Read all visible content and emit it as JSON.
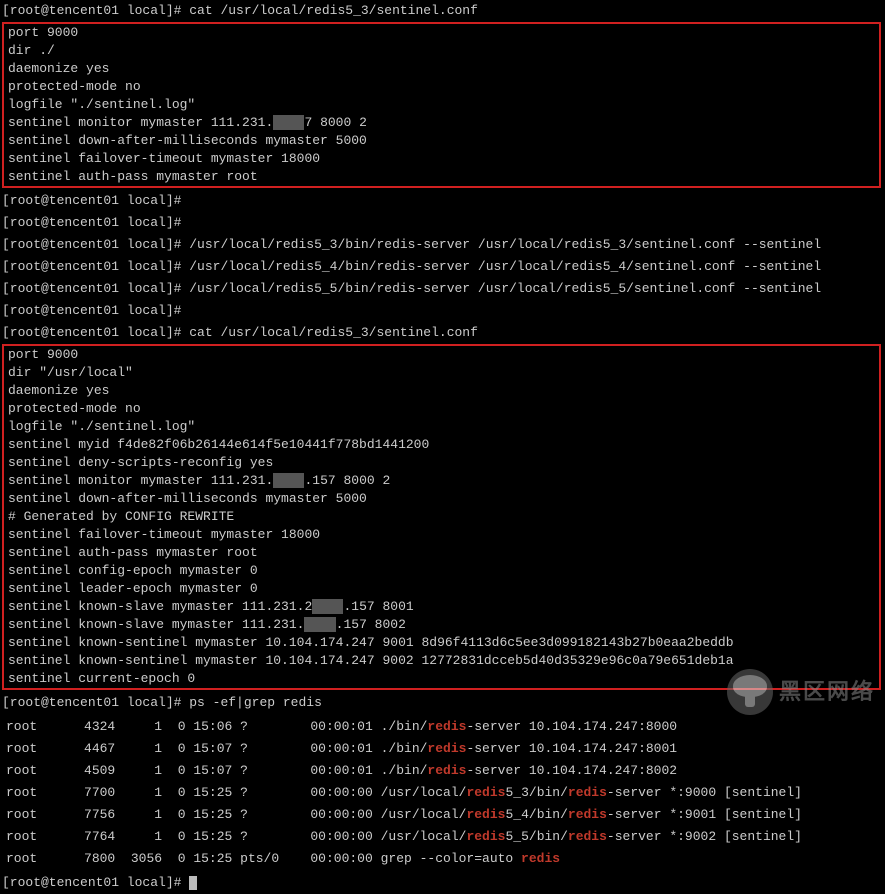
{
  "prompts": {
    "host": "[root@tencent01 local]#",
    "cmd_cat1": "cat /usr/local/redis5_3/sentinel.conf",
    "cmd_empty": "",
    "cmd_start3": "/usr/local/redis5_3/bin/redis-server /usr/local/redis5_3/sentinel.conf --sentinel",
    "cmd_start4": "/usr/local/redis5_4/bin/redis-server /usr/local/redis5_4/sentinel.conf --sentinel",
    "cmd_start5": "/usr/local/redis5_5/bin/redis-server /usr/local/redis5_5/sentinel.conf --sentinel",
    "cmd_cat2": "cat /usr/local/redis5_3/sentinel.conf",
    "cmd_ps": "ps -ef|grep redis"
  },
  "conf1": {
    "l1": "port 9000",
    "l2": "dir ./",
    "l3": "daemonize yes",
    "l4": "protected-mode no",
    "l5": "logfile \"./sentinel.log\"",
    "l6_a": "sentinel monitor mymaster 111.231.",
    "l6_b": "7 8000 2",
    "l7": "sentinel down-after-milliseconds mymaster 5000",
    "l8": "sentinel failover-timeout mymaster 18000",
    "l9": "sentinel auth-pass mymaster root"
  },
  "conf2": {
    "l1": "port 9000",
    "l2": "dir \"/usr/local\"",
    "l3": "daemonize yes",
    "l4": "protected-mode no",
    "l5": "logfile \"./sentinel.log\"",
    "l6": "sentinel myid f4de82f06b26144e614f5e10441f778bd1441200",
    "l7": "sentinel deny-scripts-reconfig yes",
    "l8_a": "sentinel monitor mymaster 111.231.",
    "l8_b": ".157 8000 2",
    "l9": "sentinel down-after-milliseconds mymaster 5000",
    "l10": "# Generated by CONFIG REWRITE",
    "l11": "sentinel failover-timeout mymaster 18000",
    "l12": "sentinel auth-pass mymaster root",
    "l13": "sentinel config-epoch mymaster 0",
    "l14": "sentinel leader-epoch mymaster 0",
    "l15_a": "sentinel known-slave mymaster 111.231.2",
    "l15_b": ".157 8001",
    "l16_a": "sentinel known-slave mymaster 111.231.",
    "l16_b": ".157 8002",
    "l17": "sentinel known-sentinel mymaster 10.104.174.247 9001 8d96f4113d6c5ee3d099182143b27b0eaa2beddb",
    "l18": "sentinel known-sentinel mymaster 10.104.174.247 9002 12772831dcceb5d40d35329e96c0a79e651deb1a",
    "l19": "sentinel current-epoch 0"
  },
  "ps": {
    "r1": {
      "user": "root",
      "pid": "4324",
      "ppid": "1",
      "c": "0",
      "stime": "15:06",
      "tty": "?",
      "time": "00:00:01",
      "pre": "./bin/",
      "cmd": "-server 10.104.174.247:8000"
    },
    "r2": {
      "user": "root",
      "pid": "4467",
      "ppid": "1",
      "c": "0",
      "stime": "15:07",
      "tty": "?",
      "time": "00:00:01",
      "pre": "./bin/",
      "cmd": "-server 10.104.174.247:8001"
    },
    "r3": {
      "user": "root",
      "pid": "4509",
      "ppid": "1",
      "c": "0",
      "stime": "15:07",
      "tty": "?",
      "time": "00:00:01",
      "pre": "./bin/",
      "cmd": "-server 10.104.174.247:8002"
    },
    "r4": {
      "user": "root",
      "pid": "7700",
      "ppid": "1",
      "c": "0",
      "stime": "15:25",
      "tty": "?",
      "time": "00:00:00",
      "pre": "/usr/local/",
      "mid": "5",
      "node": "3",
      "suf": "/bin/",
      "cmd": "-server *:9000 [sentinel]"
    },
    "r5": {
      "user": "root",
      "pid": "7756",
      "ppid": "1",
      "c": "0",
      "stime": "15:25",
      "tty": "?",
      "time": "00:00:00",
      "pre": "/usr/local/",
      "mid": "5",
      "node": "4",
      "suf": "/bin/",
      "cmd": "-server *:9001 [sentinel]"
    },
    "r6": {
      "user": "root",
      "pid": "7764",
      "ppid": "1",
      "c": "0",
      "stime": "15:25",
      "tty": "?",
      "time": "00:00:00",
      "pre": "/usr/local/",
      "mid": "5",
      "node": "5",
      "suf": "/bin/",
      "cmd": "-server *:9002 [sentinel]"
    },
    "r7": {
      "user": "root",
      "pid": "7800",
      "ppid": "3056",
      "c": "0",
      "stime": "15:25",
      "tty": "pts/0",
      "time": "00:00:00",
      "grep_pre": "grep --color=auto "
    }
  },
  "redis_kw": "redis",
  "watermark": "黑区网络",
  "masked": "    "
}
